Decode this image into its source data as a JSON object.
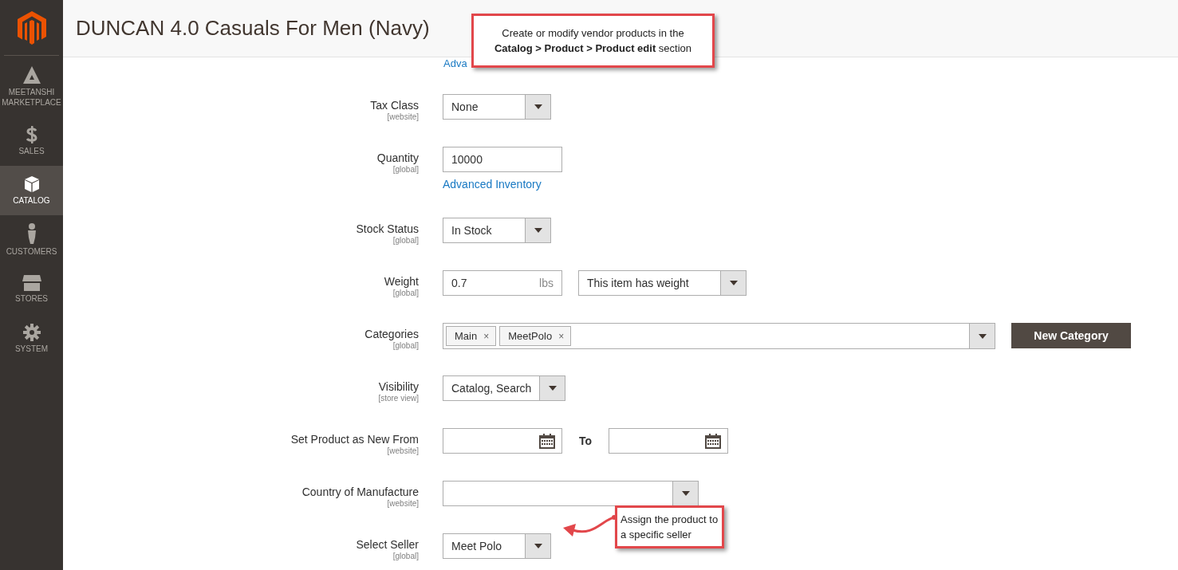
{
  "sidebar": {
    "items": [
      {
        "label": "MEETANSHI MARKETPLACE",
        "kind": "marketplace",
        "selected": false
      },
      {
        "label": "SALES",
        "kind": "sales",
        "selected": false
      },
      {
        "label": "CATALOG",
        "kind": "catalog",
        "selected": true
      },
      {
        "label": "CUSTOMERS",
        "kind": "customers",
        "selected": false
      },
      {
        "label": "STORES",
        "kind": "stores",
        "selected": false
      },
      {
        "label": "SYSTEM",
        "kind": "system",
        "selected": false
      }
    ]
  },
  "page_title": "DUNCAN 4.0 Casuals For Men (Navy)",
  "top_link": "Adva",
  "fields": [
    {
      "label": "Tax Class",
      "scope": "[website]",
      "kind": "select",
      "value": "None"
    },
    {
      "label": "Quantity",
      "scope": "[global]",
      "kind": "input",
      "value": "10000",
      "link": "Advanced Inventory"
    },
    {
      "label": "Stock Status",
      "scope": "[global]",
      "kind": "select",
      "value": "In Stock"
    },
    {
      "label": "Weight",
      "scope": "[global]",
      "kind": "weight",
      "value": "0.7",
      "unit": "lbs",
      "select_value": "This item has weight"
    },
    {
      "label": "Categories",
      "scope": "[global]",
      "kind": "multiselect",
      "tags": [
        "Main",
        "MeetPolo"
      ],
      "remove": "×",
      "button": "New Category"
    },
    {
      "label": "Visibility",
      "scope": "[store view]",
      "kind": "select",
      "value": "Catalog, Search"
    },
    {
      "label": "Set Product as New From",
      "scope": "[website]",
      "kind": "daterange",
      "to_label": "To"
    },
    {
      "label": "Country of Manufacture",
      "scope": "[website]",
      "kind": "select"
    },
    {
      "label": "Select Seller",
      "scope": "[global]",
      "kind": "select",
      "value": "Meet Polo"
    }
  ],
  "callouts": [
    {
      "text": "Create or modify vendor products in the **Catalog > Product > Product edit** section"
    },
    {
      "text": "Assign the product to a specific seller"
    }
  ]
}
